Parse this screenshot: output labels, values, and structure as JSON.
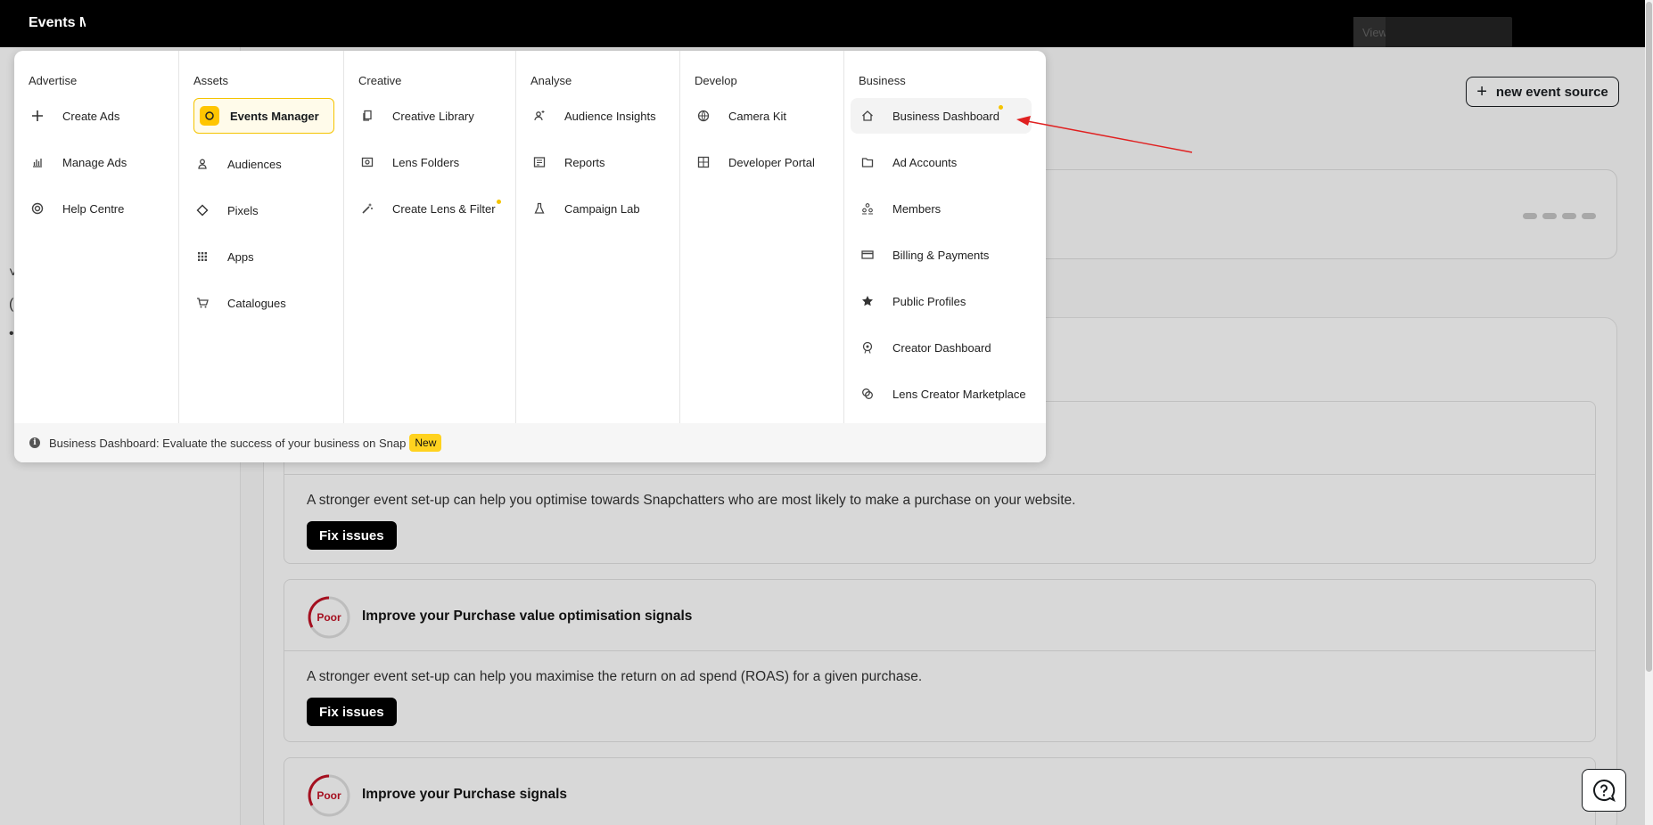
{
  "topbar": {
    "title": "Events Manager",
    "account_stub": "Viewing"
  },
  "page": {
    "new_source_label": "new event source",
    "recommendations": [
      {
        "rating": "",
        "title": "",
        "description": "A stronger event set-up can help you optimise towards Snapchatters who are most likely to make a purchase on your website.",
        "button": "Fix issues"
      },
      {
        "rating": "Poor",
        "title": "Improve your Purchase value optimisation signals",
        "description": "A stronger event set-up can help you maximise the return on ad spend (ROAS) for a given purchase.",
        "button": "Fix issues"
      },
      {
        "rating": "Poor",
        "title": "Improve your Purchase signals",
        "description": "",
        "button": ""
      }
    ]
  },
  "menu": {
    "columns": [
      {
        "heading": "Advertise",
        "items": [
          {
            "label": "Create Ads",
            "icon": "plus-icon"
          },
          {
            "label": "Manage Ads",
            "icon": "bar-chart-icon"
          },
          {
            "label": "Help Centre",
            "icon": "lifebuoy-icon"
          }
        ]
      },
      {
        "heading": "Assets",
        "items": [
          {
            "label": "Events Manager",
            "icon": "events-manager-icon",
            "active": true
          },
          {
            "label": "Audiences",
            "icon": "person-icon"
          },
          {
            "label": "Pixels",
            "icon": "diamond-icon"
          },
          {
            "label": "Apps",
            "icon": "grid-icon"
          },
          {
            "label": "Catalogues",
            "icon": "cart-icon"
          }
        ]
      },
      {
        "heading": "Creative",
        "items": [
          {
            "label": "Creative Library",
            "icon": "copy-icon"
          },
          {
            "label": "Lens Folders",
            "icon": "folder-image-icon"
          },
          {
            "label": "Create Lens & Filter",
            "icon": "magic-wand-icon",
            "new_dot": true
          }
        ]
      },
      {
        "heading": "Analyse",
        "items": [
          {
            "label": "Audience Insights",
            "icon": "person-sparkle-icon"
          },
          {
            "label": "Reports",
            "icon": "report-icon"
          },
          {
            "label": "Campaign Lab",
            "icon": "flask-icon"
          }
        ]
      },
      {
        "heading": "Develop",
        "items": [
          {
            "label": "Camera Kit",
            "icon": "globe-icon"
          },
          {
            "label": "Developer Portal",
            "icon": "portal-icon"
          }
        ]
      },
      {
        "heading": "Business",
        "items": [
          {
            "label": "Business Dashboard",
            "icon": "home-icon",
            "new_dot": true,
            "hover": true
          },
          {
            "label": "Ad Accounts",
            "icon": "folder-icon"
          },
          {
            "label": "Members",
            "icon": "members-icon"
          },
          {
            "label": "Billing & Payments",
            "icon": "card-icon"
          },
          {
            "label": "Public Profiles",
            "icon": "star-icon"
          },
          {
            "label": "Creator Dashboard",
            "icon": "location-badge-icon"
          },
          {
            "label": "Lens Creator Marketplace",
            "icon": "lens-icon"
          }
        ]
      }
    ],
    "footer": {
      "text": "Business Dashboard: Evaluate the success of your business on Snap",
      "badge": "New"
    }
  },
  "colors": {
    "accent": "#ffc500",
    "poor": "#a50f1f",
    "annotation": "#e02020"
  }
}
